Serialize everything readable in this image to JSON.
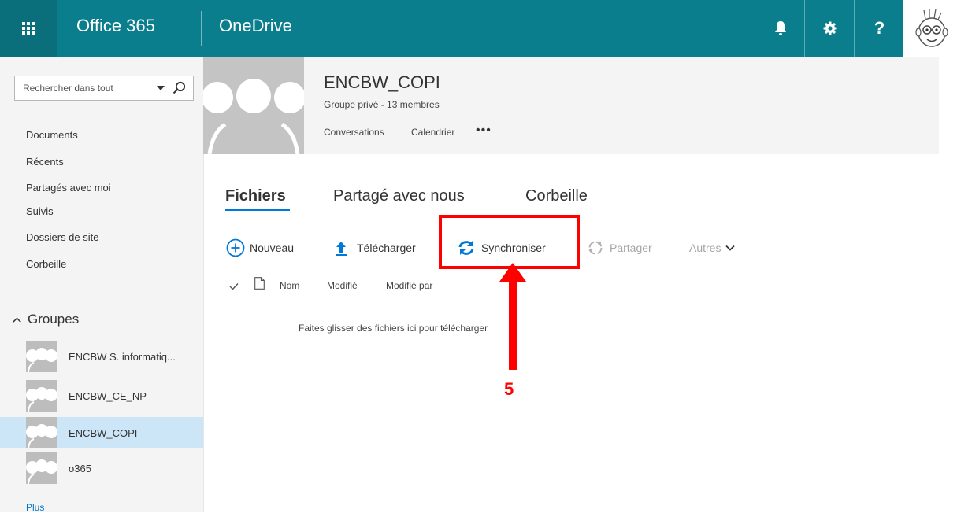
{
  "topbar": {
    "brand": "Office 365",
    "app_name": "OneDrive",
    "colors": {
      "bar": "#0a7e8c",
      "waffle": "#0a6f7b"
    },
    "icons": [
      "app-launcher-icon",
      "bell-icon",
      "gear-icon",
      "help-icon"
    ]
  },
  "search": {
    "placeholder": "Rechercher dans tout"
  },
  "nav": {
    "items": [
      "Documents",
      "Récents",
      "Partagés avec moi",
      "Suivis",
      "Dossiers de site",
      "Corbeille"
    ]
  },
  "groups": {
    "heading": "Groupes",
    "items": [
      {
        "name": "ENCBW S. informatiq...",
        "selected": false
      },
      {
        "name": "ENCBW_CE_NP",
        "selected": false
      },
      {
        "name": "ENCBW_COPI",
        "selected": true
      },
      {
        "name": "o365",
        "selected": false
      }
    ],
    "more": "Plus"
  },
  "group_header": {
    "title": "ENCBW_COPI",
    "subtitle": "Groupe privé - 13 membres",
    "links": [
      "Conversations",
      "Calendrier"
    ],
    "more": "•••"
  },
  "tabs": [
    {
      "label": "Fichiers",
      "active": true
    },
    {
      "label": "Partagé avec nous",
      "active": false
    },
    {
      "label": "Corbeille",
      "active": false
    }
  ],
  "commands": {
    "new": "Nouveau",
    "upload": "Télécharger",
    "sync": "Synchroniser",
    "share": "Partager",
    "more": "Autres"
  },
  "list": {
    "columns": [
      "Nom",
      "Modifié",
      "Modifié par"
    ],
    "empty": "Faites glisser des fichiers ici pour télécharger"
  },
  "annotation": {
    "step": "5",
    "color": "#ff0000"
  }
}
